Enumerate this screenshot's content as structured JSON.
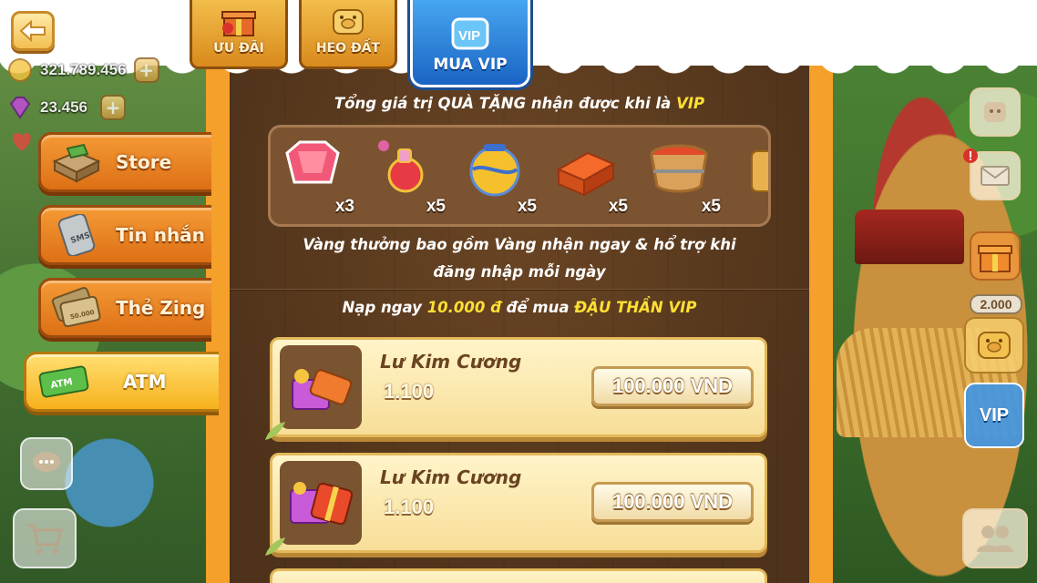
{
  "resources": {
    "gold": "321.789.456",
    "gems": "23.456"
  },
  "tabs": [
    {
      "label": "ƯU ĐÃI"
    },
    {
      "label": "HEO ĐẤT"
    },
    {
      "label": "MUA VIP",
      "icon_text": "VIP"
    }
  ],
  "menu": [
    {
      "label": "Store"
    },
    {
      "label": "Tin nhắn"
    },
    {
      "label": "Thẻ Zing"
    },
    {
      "label": "ATM",
      "active": true
    }
  ],
  "menu_icon_text": {
    "sms": "SMS",
    "card": "50.000",
    "atm": "ATM"
  },
  "headline": {
    "prefix": "Tổng giá trị QUÀ TẶNG nhận được khi là ",
    "highlight": "VIP"
  },
  "gifts": [
    {
      "name": "ruby-gem",
      "qty": "x3"
    },
    {
      "name": "potion-bottle",
      "qty": "x5"
    },
    {
      "name": "magic-jar",
      "qty": "x5"
    },
    {
      "name": "brick",
      "qty": "x5"
    },
    {
      "name": "paint-bucket",
      "qty": "x5"
    }
  ],
  "description": "Vàng thưởng bao gồm Vàng nhận ngay & hổ trợ khi đăng nhập mỗi ngày",
  "offer": {
    "prefix": "Nạp ngay ",
    "amount": "10.000 đ",
    "middle": " để mua ",
    "product": "ĐẬU THẦN VIP"
  },
  "packages": [
    {
      "title": "Lư Kim Cương",
      "amount": "1.100",
      "price": "100.000 VND"
    },
    {
      "title": "Lư Kim Cương",
      "amount": "1.100",
      "price": "100.000 VND"
    }
  ],
  "right_badge": "2.000",
  "right_vip_label": "VIP",
  "colors": {
    "accent_yellow": "#ffe033",
    "tab_active_blue": "#1a64c4",
    "menu_orange": "#f49a35",
    "board_brown": "#5a3a1d"
  }
}
